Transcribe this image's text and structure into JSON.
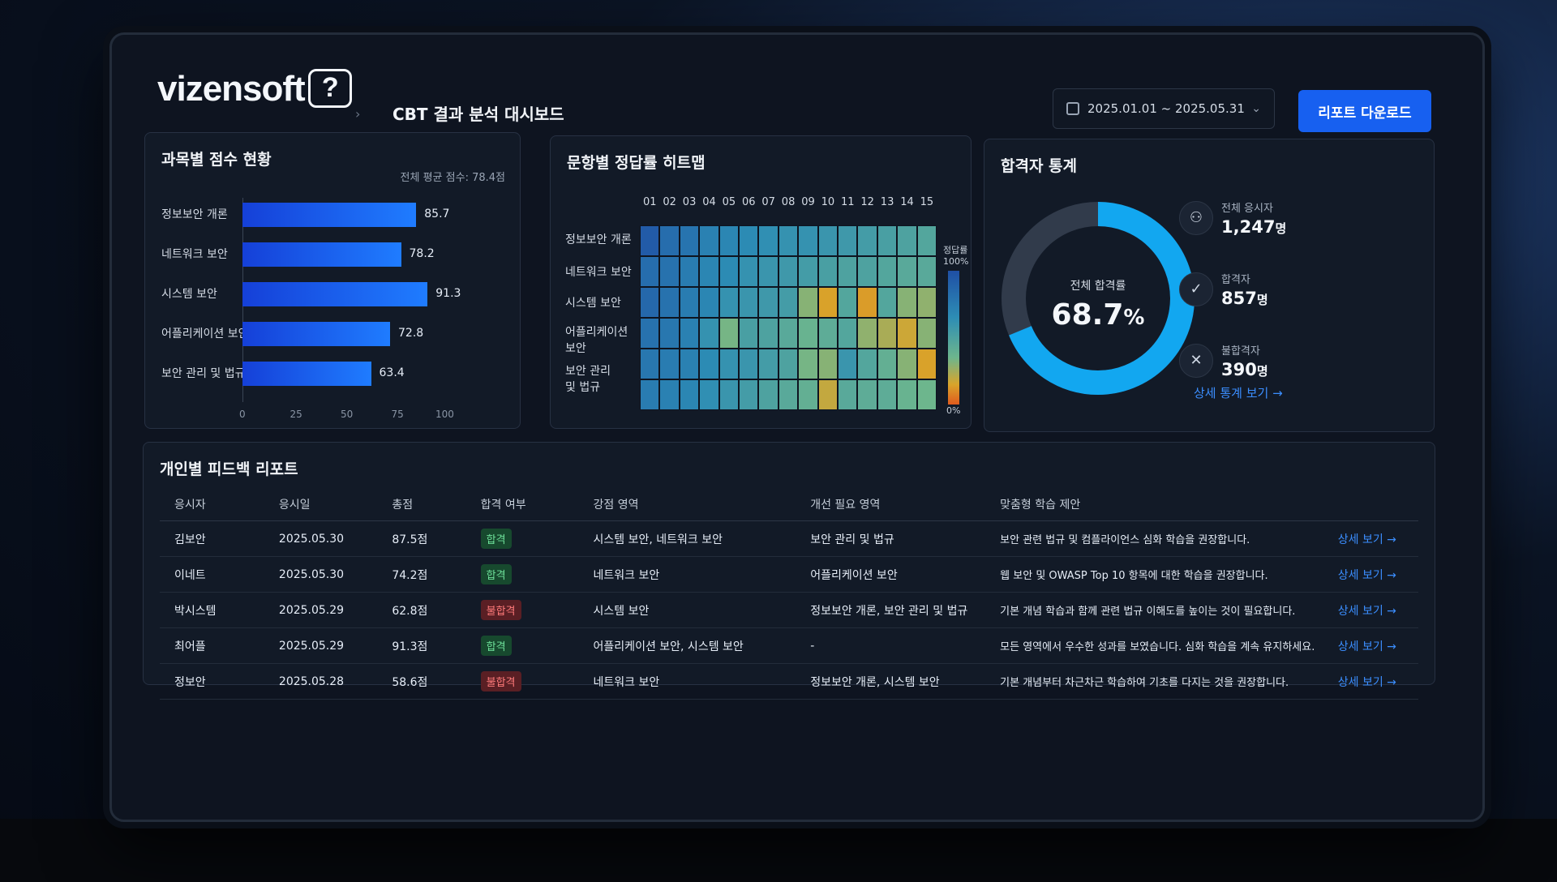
{
  "header": {
    "logo": "vizensoft",
    "logo_mark": "?",
    "title": "CBT 결과 분석 대시보드",
    "date_range": "2025.01.01 ~ 2025.05.31",
    "download_label": "리포트 다운로드"
  },
  "subject_scores": {
    "title": "과목별 점수 현황",
    "average_label": "전체 평균 점수: 78.4점",
    "chart_data": {
      "type": "bar",
      "categories": [
        "정보보안 개론",
        "네트워크 보안",
        "시스템 보안",
        "어플리케이션 보안",
        "보안 관리 및 법규"
      ],
      "values": [
        85.7,
        78.2,
        91.3,
        72.8,
        63.4
      ],
      "xlim": [
        0,
        100
      ],
      "xticks": [
        "0",
        "25",
        "50",
        "75",
        "100"
      ]
    }
  },
  "heatmap": {
    "title": "문항별 정답률 히트맵",
    "columns": [
      "01",
      "02",
      "03",
      "04",
      "05",
      "06",
      "07",
      "08",
      "09",
      "10",
      "11",
      "12",
      "13",
      "14",
      "15"
    ],
    "rows": [
      "정보보안 개론",
      "네트워크 보안",
      "시스템 보안",
      "어플리케이션\n보안",
      "보안 관리\n및 법규"
    ],
    "legend_title": "정답률",
    "legend_max": "100%",
    "legend_min": "0%",
    "chart_data": {
      "type": "heatmap",
      "x": [
        "01",
        "02",
        "03",
        "04",
        "05",
        "06",
        "07",
        "08",
        "09",
        "10",
        "11",
        "12",
        "13",
        "14",
        "15"
      ],
      "y": [
        "정보보안 개론",
        "네트워크 보안",
        "시스템 보안",
        "어플리케이션 보안",
        "보안 관리 및 법규"
      ],
      "values": [
        [
          95,
          88,
          85,
          80,
          78,
          76,
          74,
          72,
          72,
          70,
          68,
          66,
          64,
          62,
          60
        ],
        [
          88,
          86,
          82,
          78,
          76,
          72,
          70,
          68,
          66,
          64,
          62,
          62,
          60,
          58,
          58
        ],
        [
          90,
          86,
          82,
          78,
          72,
          70,
          68,
          66,
          44,
          24,
          60,
          22,
          60,
          44,
          42
        ],
        [
          86,
          84,
          80,
          72,
          48,
          64,
          62,
          58,
          52,
          56,
          60,
          42,
          36,
          28,
          44
        ],
        [
          84,
          82,
          80,
          76,
          72,
          70,
          66,
          62,
          48,
          44,
          70,
          60,
          54,
          44,
          24
        ],
        [
          82,
          80,
          78,
          74,
          70,
          66,
          62,
          58,
          54,
          30,
          58,
          56,
          56,
          52,
          50
        ]
      ]
    }
  },
  "pass_stats": {
    "title": "합격자 통계",
    "donut_label": "전체 합격률",
    "donut_value": "68.7",
    "donut_unit": "%",
    "chart_data": {
      "type": "pie",
      "categories": [
        "합격",
        "불합격"
      ],
      "values": [
        68.7,
        31.3
      ]
    },
    "items": [
      {
        "label": "전체 응시자",
        "value": "1,247",
        "unit": "명",
        "icon": "user-icon"
      },
      {
        "label": "합격자",
        "value": "857",
        "unit": "명",
        "icon": "shield-check-icon"
      },
      {
        "label": "불합격자",
        "value": "390",
        "unit": "명",
        "icon": "x-circle-icon"
      }
    ],
    "more_link": "상세 통계 보기 →"
  },
  "feedback": {
    "title": "개인별 피드백 리포트",
    "columns": [
      "응시자",
      "응시일",
      "총점",
      "합격 여부",
      "강점 영역",
      "개선 필요 영역",
      "맞춤형 학습 제안",
      ""
    ],
    "rows": [
      {
        "name": "김보안",
        "date": "2025.05.30",
        "score": "87.5점",
        "result": "합격",
        "pass": true,
        "strength": "시스템 보안, 네트워크 보안",
        "improve": "보안 관리 및 법규",
        "suggestion": "보안 관련 법규 및 컴플라이언스 심화 학습을 권장합니다.",
        "detail": "상세 보기 →"
      },
      {
        "name": "이네트",
        "date": "2025.05.30",
        "score": "74.2점",
        "result": "합격",
        "pass": true,
        "strength": "네트워크 보안",
        "improve": "어플리케이션 보안",
        "suggestion": "웹 보안 및 OWASP Top 10 항목에 대한 학습을 권장합니다.",
        "detail": "상세 보기 →"
      },
      {
        "name": "박시스템",
        "date": "2025.05.29",
        "score": "62.8점",
        "result": "불합격",
        "pass": false,
        "strength": "시스템 보안",
        "improve": "정보보안 개론, 보안 관리 및 법규",
        "suggestion": "기본 개념 학습과 함께 관련 법규 이해도를 높이는 것이 필요합니다.",
        "detail": "상세 보기 →"
      },
      {
        "name": "최어플",
        "date": "2025.05.29",
        "score": "91.3점",
        "result": "합격",
        "pass": true,
        "strength": "어플리케이션 보안, 시스템 보안",
        "improve": "-",
        "suggestion": "모든 영역에서 우수한 성과를 보였습니다. 심화 학습을 계속 유지하세요.",
        "detail": "상세 보기 →"
      },
      {
        "name": "정보안",
        "date": "2025.05.28",
        "score": "58.6점",
        "result": "불합격",
        "pass": false,
        "strength": "네트워크 보안",
        "improve": "정보보안 개론, 시스템 보안",
        "suggestion": "기본 개념부터 차근차근 학습하여 기초를 다지는 것을 권장합니다.",
        "detail": "상세 보기 →"
      }
    ]
  },
  "colors": {
    "accent": "#1760f0",
    "donut_pass": "#12a7f0",
    "donut_fail": "#313b4b",
    "pass_badge": "#17492e",
    "fail_badge": "#5a1f24"
  }
}
